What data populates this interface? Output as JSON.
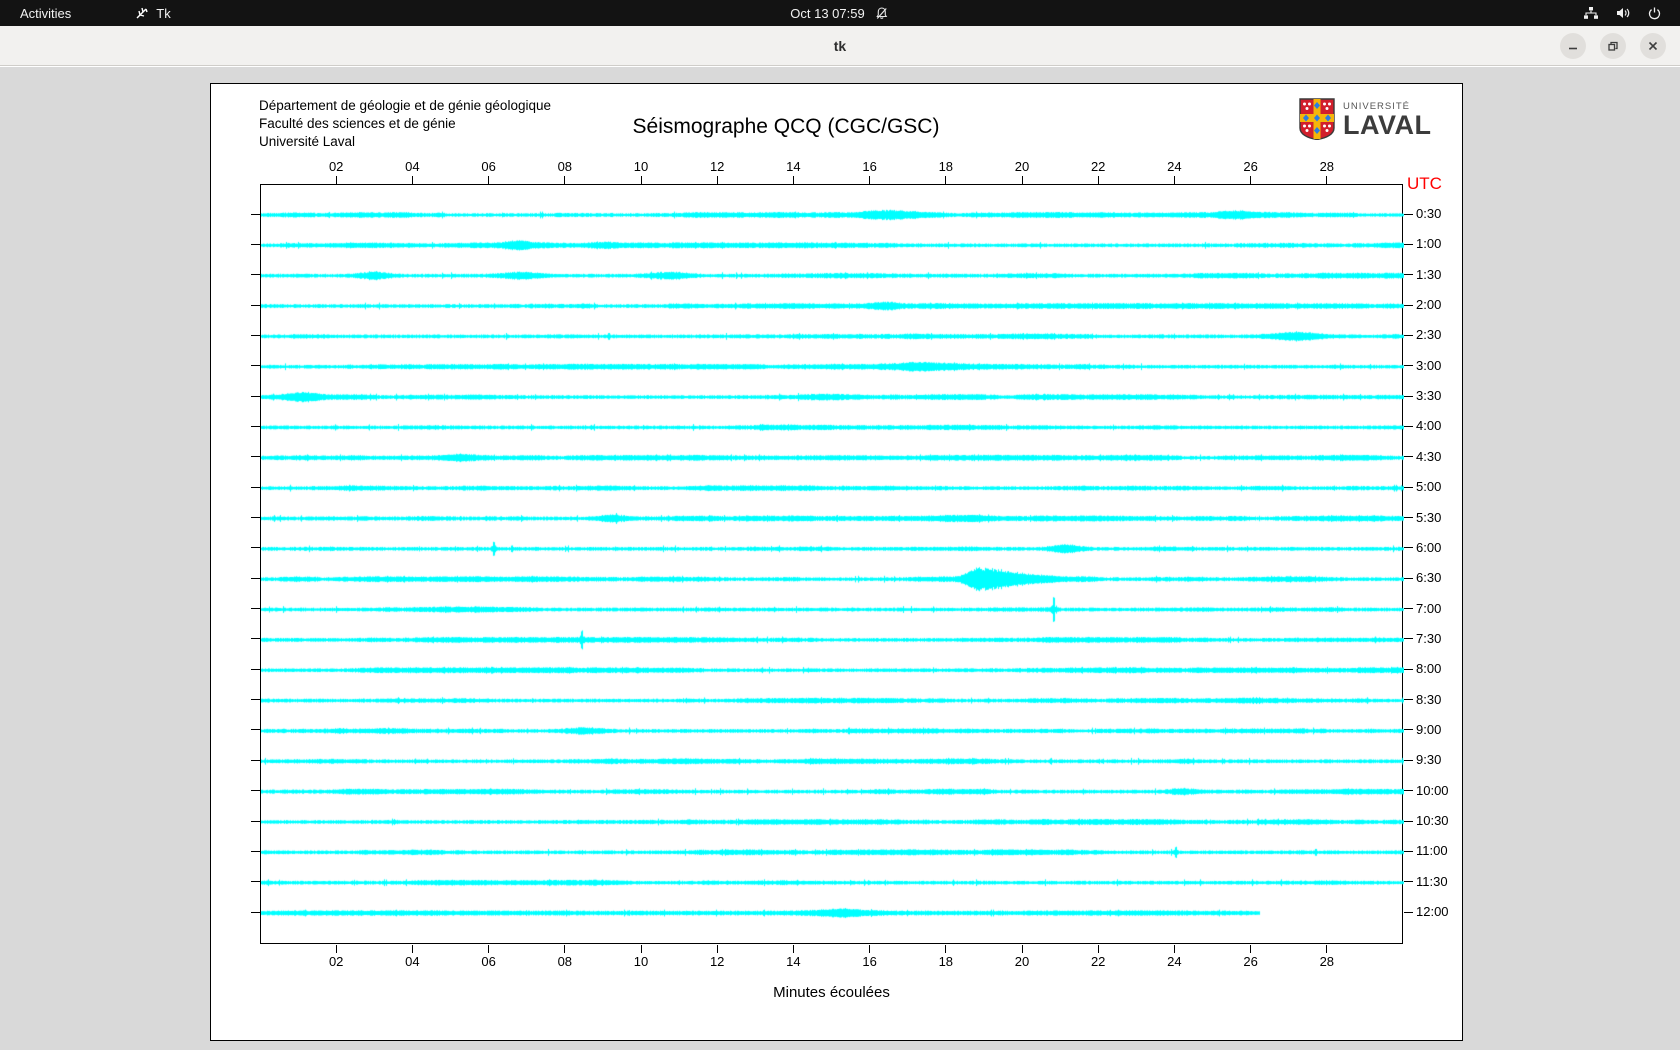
{
  "top_bar": {
    "activities_label": "Activities",
    "app_name": "Tk",
    "clock": "Oct 13 07:59",
    "icons": [
      "tk-icon",
      "bell-muted-icon",
      "network-icon",
      "volume-icon",
      "power-icon"
    ]
  },
  "window": {
    "title": "tk",
    "buttons": [
      "minimize",
      "maximize",
      "close"
    ]
  },
  "header": {
    "line1": "Département de géologie et de génie géologique",
    "line2": "Faculté des sciences et de génie",
    "line3": "Université Laval",
    "title": "Séismographe QCQ (CGC/GSC)"
  },
  "logo": {
    "small_text": "UNIVERSITÉ",
    "big_text": "LAVAL",
    "shield_red": "#d21f2c",
    "shield_gold": "#f5b50a",
    "shield_blue": "#2a7de1"
  },
  "chart_data": {
    "type": "line",
    "subtype": "seismogram-helicorder",
    "title": "Séismographe QCQ (CGC/GSC)",
    "xlabel": "Minutes écoulées",
    "right_axis_label": "UTC",
    "x_range_minutes": [
      0,
      30
    ],
    "x_ticks": [
      "02",
      "04",
      "06",
      "08",
      "10",
      "12",
      "14",
      "16",
      "18",
      "20",
      "22",
      "24",
      "26",
      "28"
    ],
    "grid": false,
    "trace_color": "#00ffff",
    "axis_color": "#000000",
    "utc_color": "#ff0000",
    "row_labels": [
      "0:30",
      "1:00",
      "1:30",
      "2:00",
      "2:30",
      "3:00",
      "3:30",
      "4:00",
      "4:30",
      "5:00",
      "5:30",
      "6:00",
      "6:30",
      "7:00",
      "7:30",
      "8:00",
      "8:30",
      "9:00",
      "9:30",
      "10:00",
      "10:30",
      "11:00",
      "11:30",
      "12:00"
    ],
    "rows": 24,
    "minutes_per_row": 30,
    "last_row_end_minute": 26.2,
    "events": [
      {
        "row": 0,
        "minute": 16.5,
        "type": "burst",
        "amp": 3.0,
        "width": 0.5
      },
      {
        "row": 0,
        "minute": 25.6,
        "type": "burst",
        "amp": 2.0,
        "width": 0.4
      },
      {
        "row": 1,
        "minute": 6.7,
        "type": "burst",
        "amp": 2.6,
        "width": 0.3
      },
      {
        "row": 1,
        "minute": 9.0,
        "type": "burst",
        "amp": 2.0,
        "width": 0.3
      },
      {
        "row": 2,
        "minute": 3.0,
        "type": "burst",
        "amp": 2.6,
        "width": 0.3
      },
      {
        "row": 2,
        "minute": 6.8,
        "type": "burst",
        "amp": 2.6,
        "width": 0.4
      },
      {
        "row": 2,
        "minute": 10.7,
        "type": "burst",
        "amp": 2.6,
        "width": 0.4
      },
      {
        "row": 3,
        "minute": 16.3,
        "type": "burst",
        "amp": 2.2,
        "width": 0.3
      },
      {
        "row": 4,
        "minute": 27.2,
        "type": "burst",
        "amp": 3.0,
        "width": 0.5
      },
      {
        "row": 5,
        "minute": 17.4,
        "type": "burst",
        "amp": 2.4,
        "width": 0.6
      },
      {
        "row": 6,
        "minute": 1.1,
        "type": "burst",
        "amp": 2.6,
        "width": 0.3
      },
      {
        "row": 6,
        "minute": 14.8,
        "type": "burst",
        "amp": 2.0,
        "width": 0.5
      },
      {
        "row": 8,
        "minute": 5.3,
        "type": "burst",
        "amp": 2.2,
        "width": 0.3
      },
      {
        "row": 10,
        "minute": 9.2,
        "type": "burst",
        "amp": 2.6,
        "width": 0.3
      },
      {
        "row": 10,
        "minute": 18.3,
        "type": "burst",
        "amp": 2.2,
        "width": 0.6
      },
      {
        "row": 11,
        "minute": 6.1,
        "type": "spike",
        "amp": 6.0,
        "width": 0.05
      },
      {
        "row": 11,
        "minute": 21.1,
        "type": "burst",
        "amp": 3.2,
        "width": 0.3
      },
      {
        "row": 12,
        "minute": 18.8,
        "type": "burst",
        "amp": 9.5,
        "width": 0.45
      },
      {
        "row": 13,
        "minute": 20.8,
        "type": "spike",
        "amp": 11.0,
        "width": 0.05
      },
      {
        "row": 14,
        "minute": 8.4,
        "type": "spike",
        "amp": 7.0,
        "width": 0.05
      },
      {
        "row": 17,
        "minute": 8.5,
        "type": "burst",
        "amp": 2.2,
        "width": 0.4
      },
      {
        "row": 19,
        "minute": 24.2,
        "type": "burst",
        "amp": 2.0,
        "width": 0.3
      },
      {
        "row": 21,
        "minute": 24.0,
        "type": "spike",
        "amp": 4.0,
        "width": 0.05
      },
      {
        "row": 23,
        "minute": 15.3,
        "type": "burst",
        "amp": 2.4,
        "width": 0.5
      }
    ]
  }
}
